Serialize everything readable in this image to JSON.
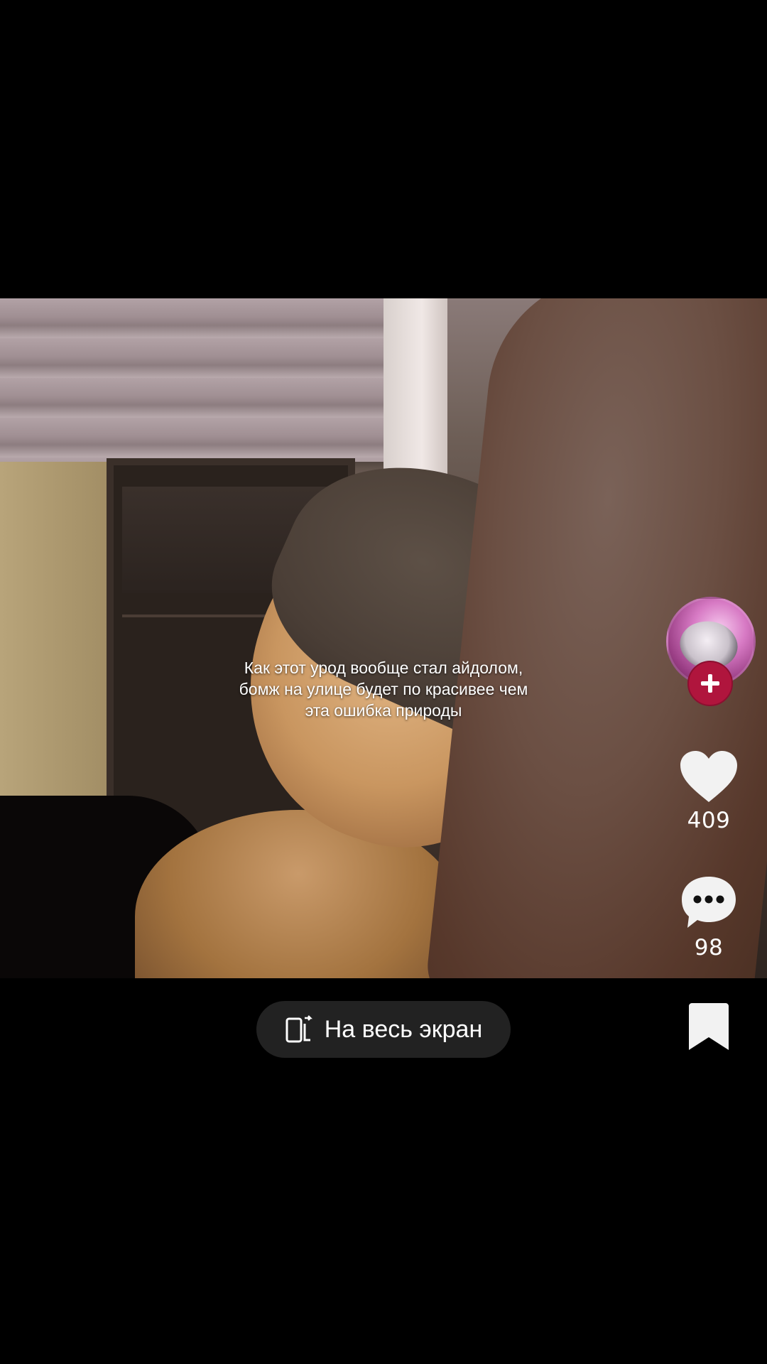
{
  "video": {
    "caption": "Как этот урод вообще стал айдолом, бомж на улице будет по красивее чем эта ошибка природы"
  },
  "actions": {
    "likes": "409",
    "comments": "98"
  },
  "fullscreen": {
    "label": "На весь экран"
  },
  "colors": {
    "background": "#000000",
    "follow_button": "#b0153d",
    "pill": "#222222",
    "icon": "#ffffff"
  },
  "icons": [
    "avatar",
    "plus-icon",
    "heart-icon",
    "comment-icon",
    "fullscreen-icon",
    "bookmark-icon"
  ]
}
